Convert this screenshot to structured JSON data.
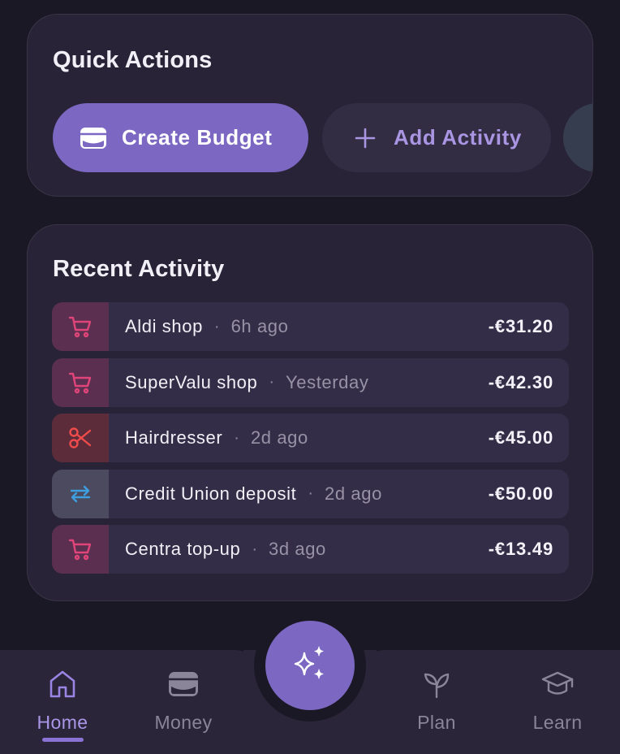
{
  "quick_actions": {
    "title": "Quick Actions",
    "create_budget": "Create Budget",
    "add_activity": "Add Activity"
  },
  "recent_activity": {
    "title": "Recent Activity",
    "items": [
      {
        "label": "Aldi shop",
        "time": "6h ago",
        "amount": "-€31.20",
        "icon": "cart-icon"
      },
      {
        "label": "SuperValu shop",
        "time": "Yesterday",
        "amount": "-€42.30",
        "icon": "cart-icon"
      },
      {
        "label": "Hairdresser",
        "time": "2d ago",
        "amount": "-€45.00",
        "icon": "scissors-icon"
      },
      {
        "label": "Credit Union deposit",
        "time": "2d ago",
        "amount": "-€50.00",
        "icon": "transfer-arrows-icon"
      },
      {
        "label": "Centra top-up",
        "time": "3d ago",
        "amount": "-€13.49",
        "icon": "cart-icon"
      }
    ],
    "separator": "·"
  },
  "nav": {
    "home": "Home",
    "money": "Money",
    "plan": "Plan",
    "learn": "Learn",
    "fab_icon": "sparkle-icon"
  },
  "colors": {
    "accent": "#7c68c2",
    "background": "#1b1826",
    "card": "#282337",
    "cart": "#e0457a",
    "scissors": "#ef4b4b",
    "transfer": "#3d9fe0"
  }
}
